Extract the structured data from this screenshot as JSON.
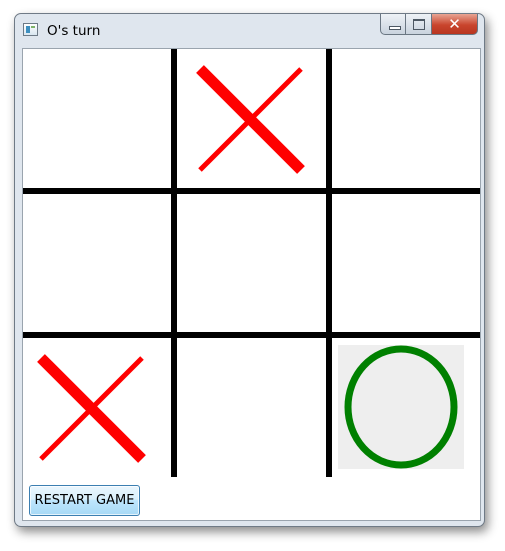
{
  "window": {
    "title": "O's turn",
    "icon": "app-window-icon",
    "controls": {
      "minimize": "minimize-icon",
      "maximize": "maximize-icon",
      "close_glyph": "✕"
    }
  },
  "game": {
    "board": [
      [
        "",
        "X",
        ""
      ],
      [
        "",
        "",
        ""
      ],
      [
        "X",
        "",
        "O"
      ]
    ],
    "highlighted_cell": [
      2,
      2
    ],
    "colors": {
      "x": "#ff0000",
      "o": "#008000",
      "grid": "#000000",
      "highlight": "#eeeeee"
    }
  },
  "controls": {
    "restart_label": "RESTART GAME"
  }
}
